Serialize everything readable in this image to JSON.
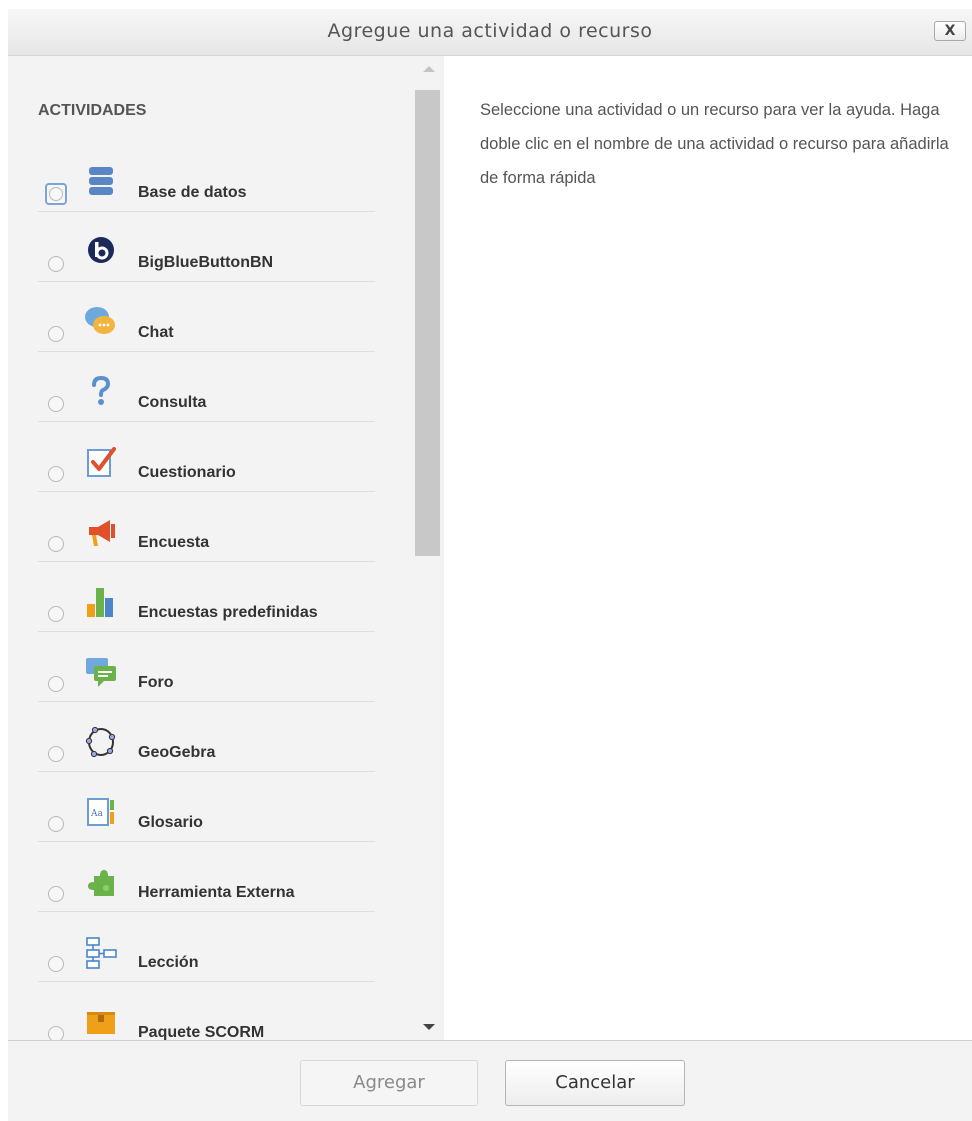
{
  "dialog": {
    "title": "Agregue una actividad o recurso",
    "close_label": "X"
  },
  "activities": {
    "heading": "ACTIVIDADES",
    "items": [
      {
        "label": "Base de datos",
        "icon": "database-icon",
        "focused": true
      },
      {
        "label": "BigBlueButtonBN",
        "icon": "bigbluebutton-icon"
      },
      {
        "label": "Chat",
        "icon": "chat-bubble-icon"
      },
      {
        "label": "Consulta",
        "icon": "question-mark-icon"
      },
      {
        "label": "Cuestionario",
        "icon": "checkmark-document-icon"
      },
      {
        "label": "Encuesta",
        "icon": "megaphone-icon"
      },
      {
        "label": "Encuestas predefinidas",
        "icon": "bar-chart-icon"
      },
      {
        "label": "Foro",
        "icon": "forum-bubbles-icon"
      },
      {
        "label": "GeoGebra",
        "icon": "geogebra-icon"
      },
      {
        "label": "Glosario",
        "icon": "glossary-book-icon"
      },
      {
        "label": "Herramienta Externa",
        "icon": "puzzle-piece-icon"
      },
      {
        "label": "Lección",
        "icon": "lesson-flowchart-icon"
      },
      {
        "label": "Paquete SCORM",
        "icon": "scorm-package-icon"
      }
    ]
  },
  "help": {
    "text": "Seleccione una actividad o un recurso para ver la ayuda. Haga doble clic en el nombre de una actividad o recurso para añadirla de forma rápida"
  },
  "footer": {
    "add_label": "Agregar",
    "cancel_label": "Cancelar"
  },
  "colors": {
    "panel_background": "#f3f3f3",
    "accent_orange": "#f0a018",
    "accent_blue": "#4a86c8"
  }
}
